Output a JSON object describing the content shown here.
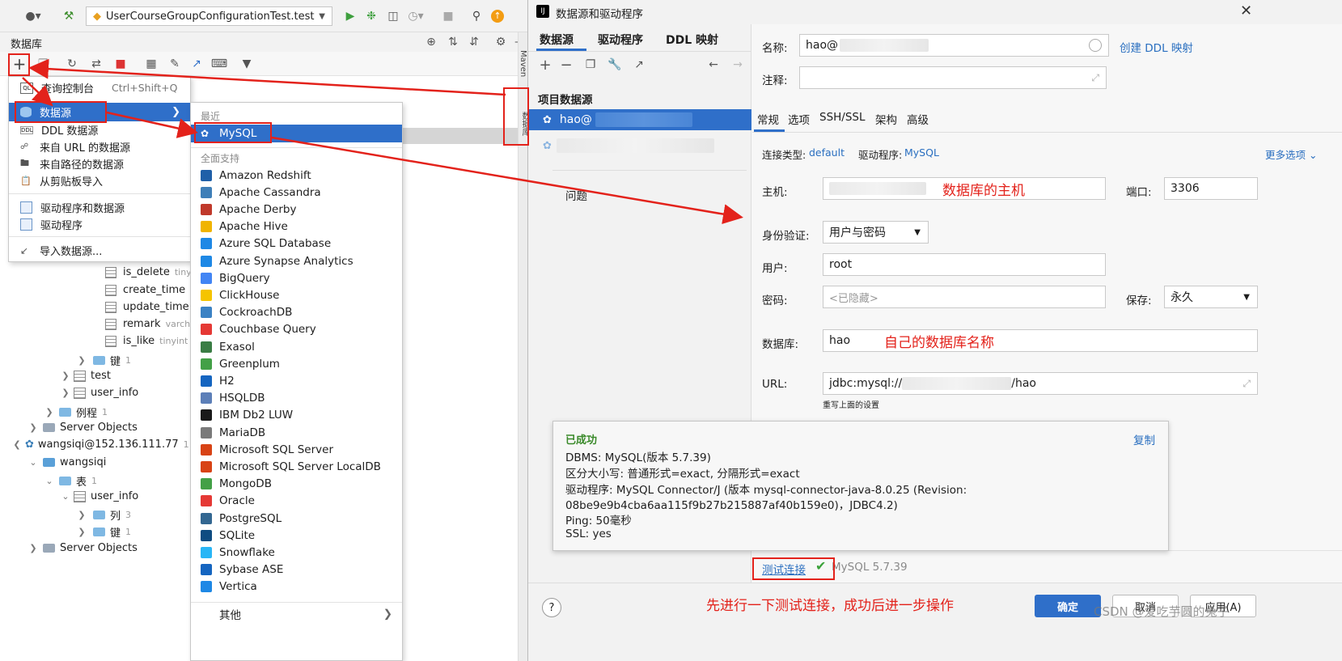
{
  "toolbar": {
    "run_config": "UserCourseGroupConfigurationTest.test"
  },
  "db_panel": {
    "title": "数据库",
    "tree": [
      {
        "label": "is_delete",
        "type": "column",
        "hint": "tiny"
      },
      {
        "label": "create_time",
        "type": "column",
        "hint": ""
      },
      {
        "label": "update_time",
        "type": "column",
        "hint": ""
      },
      {
        "label": "remark",
        "type": "column",
        "hint": "varch"
      },
      {
        "label": "is_like",
        "type": "column",
        "hint": "tinyint"
      },
      {
        "label": "键",
        "type": "folder",
        "count": "1"
      },
      {
        "label": "test",
        "type": "table"
      },
      {
        "label": "user_info",
        "type": "table"
      },
      {
        "label": "例程",
        "type": "folder",
        "count": "1"
      },
      {
        "label": "Server Objects",
        "type": "server"
      },
      {
        "label": "wangsiqi@152.136.111.77",
        "type": "datasource",
        "count": "1"
      },
      {
        "label": "wangsiqi",
        "type": "schema"
      },
      {
        "label": "表",
        "type": "folder",
        "count": "1"
      },
      {
        "label": "user_info",
        "type": "table"
      },
      {
        "label": "列",
        "type": "folder",
        "count": "3"
      },
      {
        "label": "键",
        "type": "folder",
        "count": "1"
      },
      {
        "label": "Server Objects",
        "type": "server"
      }
    ]
  },
  "side_strip": {
    "maven": "Maven",
    "db": "数据库"
  },
  "add_menu": {
    "items": [
      {
        "label": "查询控制台",
        "shortcut": "Ctrl+Shift+Q"
      },
      {
        "label": "数据源",
        "shortcut": ""
      },
      {
        "label": "DDL 数据源",
        "shortcut": ""
      },
      {
        "label": "来自 URL 的数据源",
        "shortcut": ""
      },
      {
        "label": "来自路径的数据源",
        "shortcut": ""
      },
      {
        "label": "从剪贴板导入",
        "shortcut": ""
      },
      {
        "label": "驱动程序和数据源",
        "shortcut": ""
      },
      {
        "label": "驱动程序",
        "shortcut": ""
      },
      {
        "label": "导入数据源...",
        "shortcut": ""
      }
    ]
  },
  "ds_menu": {
    "recent_header": "最近",
    "recent": "MySQL",
    "all_header": "全面支持",
    "items": [
      "Amazon Redshift",
      "Apache Cassandra",
      "Apache Derby",
      "Apache Hive",
      "Azure SQL Database",
      "Azure Synapse Analytics",
      "BigQuery",
      "ClickHouse",
      "CockroachDB",
      "Couchbase Query",
      "Exasol",
      "Greenplum",
      "H2",
      "HSQLDB",
      "IBM Db2 LUW",
      "MariaDB",
      "Microsoft SQL Server",
      "Microsoft SQL Server LocalDB",
      "MongoDB",
      "Oracle",
      "PostgreSQL",
      "SQLite",
      "Snowflake",
      "Sybase ASE",
      "Vertica"
    ],
    "colors": [
      "#1f5fa8",
      "#3f7fb8",
      "#c0392b",
      "#f0b400",
      "#1e88e5",
      "#1e88e5",
      "#4285f4",
      "#f5c400",
      "#3b82c4",
      "#e53935",
      "#3a7d44",
      "#43a047",
      "#1565c0",
      "#5c7fb8",
      "#1a1a1a",
      "#7a7a7a",
      "#d84315",
      "#d84315",
      "#43a047",
      "#e53935",
      "#336791",
      "#0f4c81",
      "#29b6f6",
      "#1565c0",
      "#1e88e5"
    ],
    "other": "其他"
  },
  "dialog": {
    "title": "数据源和驱动程序",
    "left_tabs": [
      "数据源",
      "驱动程序",
      "DDL 映射"
    ],
    "project_header": "项目数据源",
    "selected_ds": "hao@",
    "problems": "问题",
    "name_label": "名称:",
    "name_value": "hao@",
    "create_ddl": "创建 DDL 映射",
    "comment_label": "注释:",
    "tabs": [
      "常规",
      "选项",
      "SSH/SSL",
      "架构",
      "高级"
    ],
    "conn_type_label": "连接类型:",
    "conn_type_value": "default",
    "driver_label": "驱动程序:",
    "driver_value": "MySQL",
    "more_options": "更多选项",
    "host_label": "主机:",
    "host_note": "数据库的主机",
    "port_label": "端口:",
    "port_value": "3306",
    "auth_label": "身份验证:",
    "auth_value": "用户与密码",
    "user_label": "用户:",
    "user_value": "root",
    "password_label": "密码:",
    "password_placeholder": "<已隐藏>",
    "save_label": "保存:",
    "save_value": "永久",
    "database_label": "数据库:",
    "database_value": "hao",
    "database_note": "自己的数据库名称",
    "url_label": "URL:",
    "url_prefix": "jdbc:mysql://",
    "url_suffix": "/hao",
    "url_hint": "重写上面的设置",
    "success": {
      "title": "已成功",
      "copy": "复制",
      "lines": [
        "DBMS: MySQL(版本 5.7.39)",
        "区分大小写: 普通形式=exact, 分隔形式=exact",
        "驱动程序: MySQL Connector/J (版本 mysql-connector-java-8.0.25 (Revision:",
        "08be9e9b4cba6aa115f9b27b215887af40b159e0)，JDBC4.2)",
        "Ping: 50毫秒",
        "SSL: yes"
      ]
    },
    "test_conn": "测试连接",
    "test_version": "MySQL 5.7.39",
    "bottom_note": "先进行一下测试连接，成功后进一步操作",
    "ok": "确定",
    "cancel": "取消",
    "apply": "应用(A)",
    "help": "?"
  },
  "watermark": "CSDN @爱吃芋圆的兔子",
  "colors": {
    "accent": "#2f6fc9",
    "annotation": "#e3221b",
    "selection": "#2f6fc9"
  }
}
